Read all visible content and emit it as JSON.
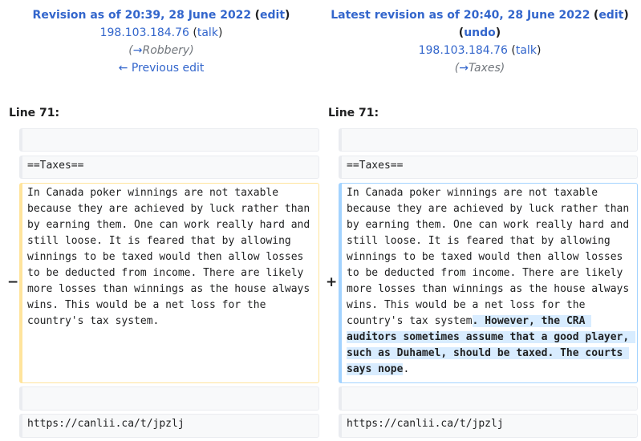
{
  "left_header": {
    "title": "Revision as of 20:39, 28 June 2022",
    "edit_label": "edit",
    "user": "198.103.184.76",
    "talk_label": "talk",
    "summary_arrow": "→",
    "summary_text": "Robbery",
    "prev_edit_label": "← Previous edit"
  },
  "right_header": {
    "title": "Latest revision as of 20:40, 28 June 2022",
    "edit_label": "edit",
    "undo_label": "undo",
    "user": "198.103.184.76",
    "talk_label": "talk",
    "summary_arrow": "→",
    "summary_text": "Taxes"
  },
  "diff": {
    "left_line": "Line 71:",
    "right_line": "Line 71:",
    "minus": "−",
    "plus": "+",
    "context_heading": "==Taxes==",
    "deleted_text": "In Canada poker winnings are not taxable because they are achieved by luck rather than by earning them. One can work really hard and still loose. It is feared that by allowing winnings to be taxed would then allow losses to be deducted from income. There are likely more losses than winnings as the house always wins. This would be a net loss for the country's tax system.",
    "added_text_base": "In Canada poker winnings are not taxable because they are achieved by luck rather than by earning them. One can work really hard and still loose. It is feared that by allowing winnings to be taxed would then allow losses to be deducted from income. There are likely more losses than winnings as the house always wins. This would be a net loss for the country's tax system",
    "added_text_inserted": ". However, the CRA auditors sometimes assume that a good player, such as Duhamel, should be taxed. The courts says nope",
    "added_text_tail": ".",
    "context_url": "https://canlii.ca/t/jpzlj"
  }
}
